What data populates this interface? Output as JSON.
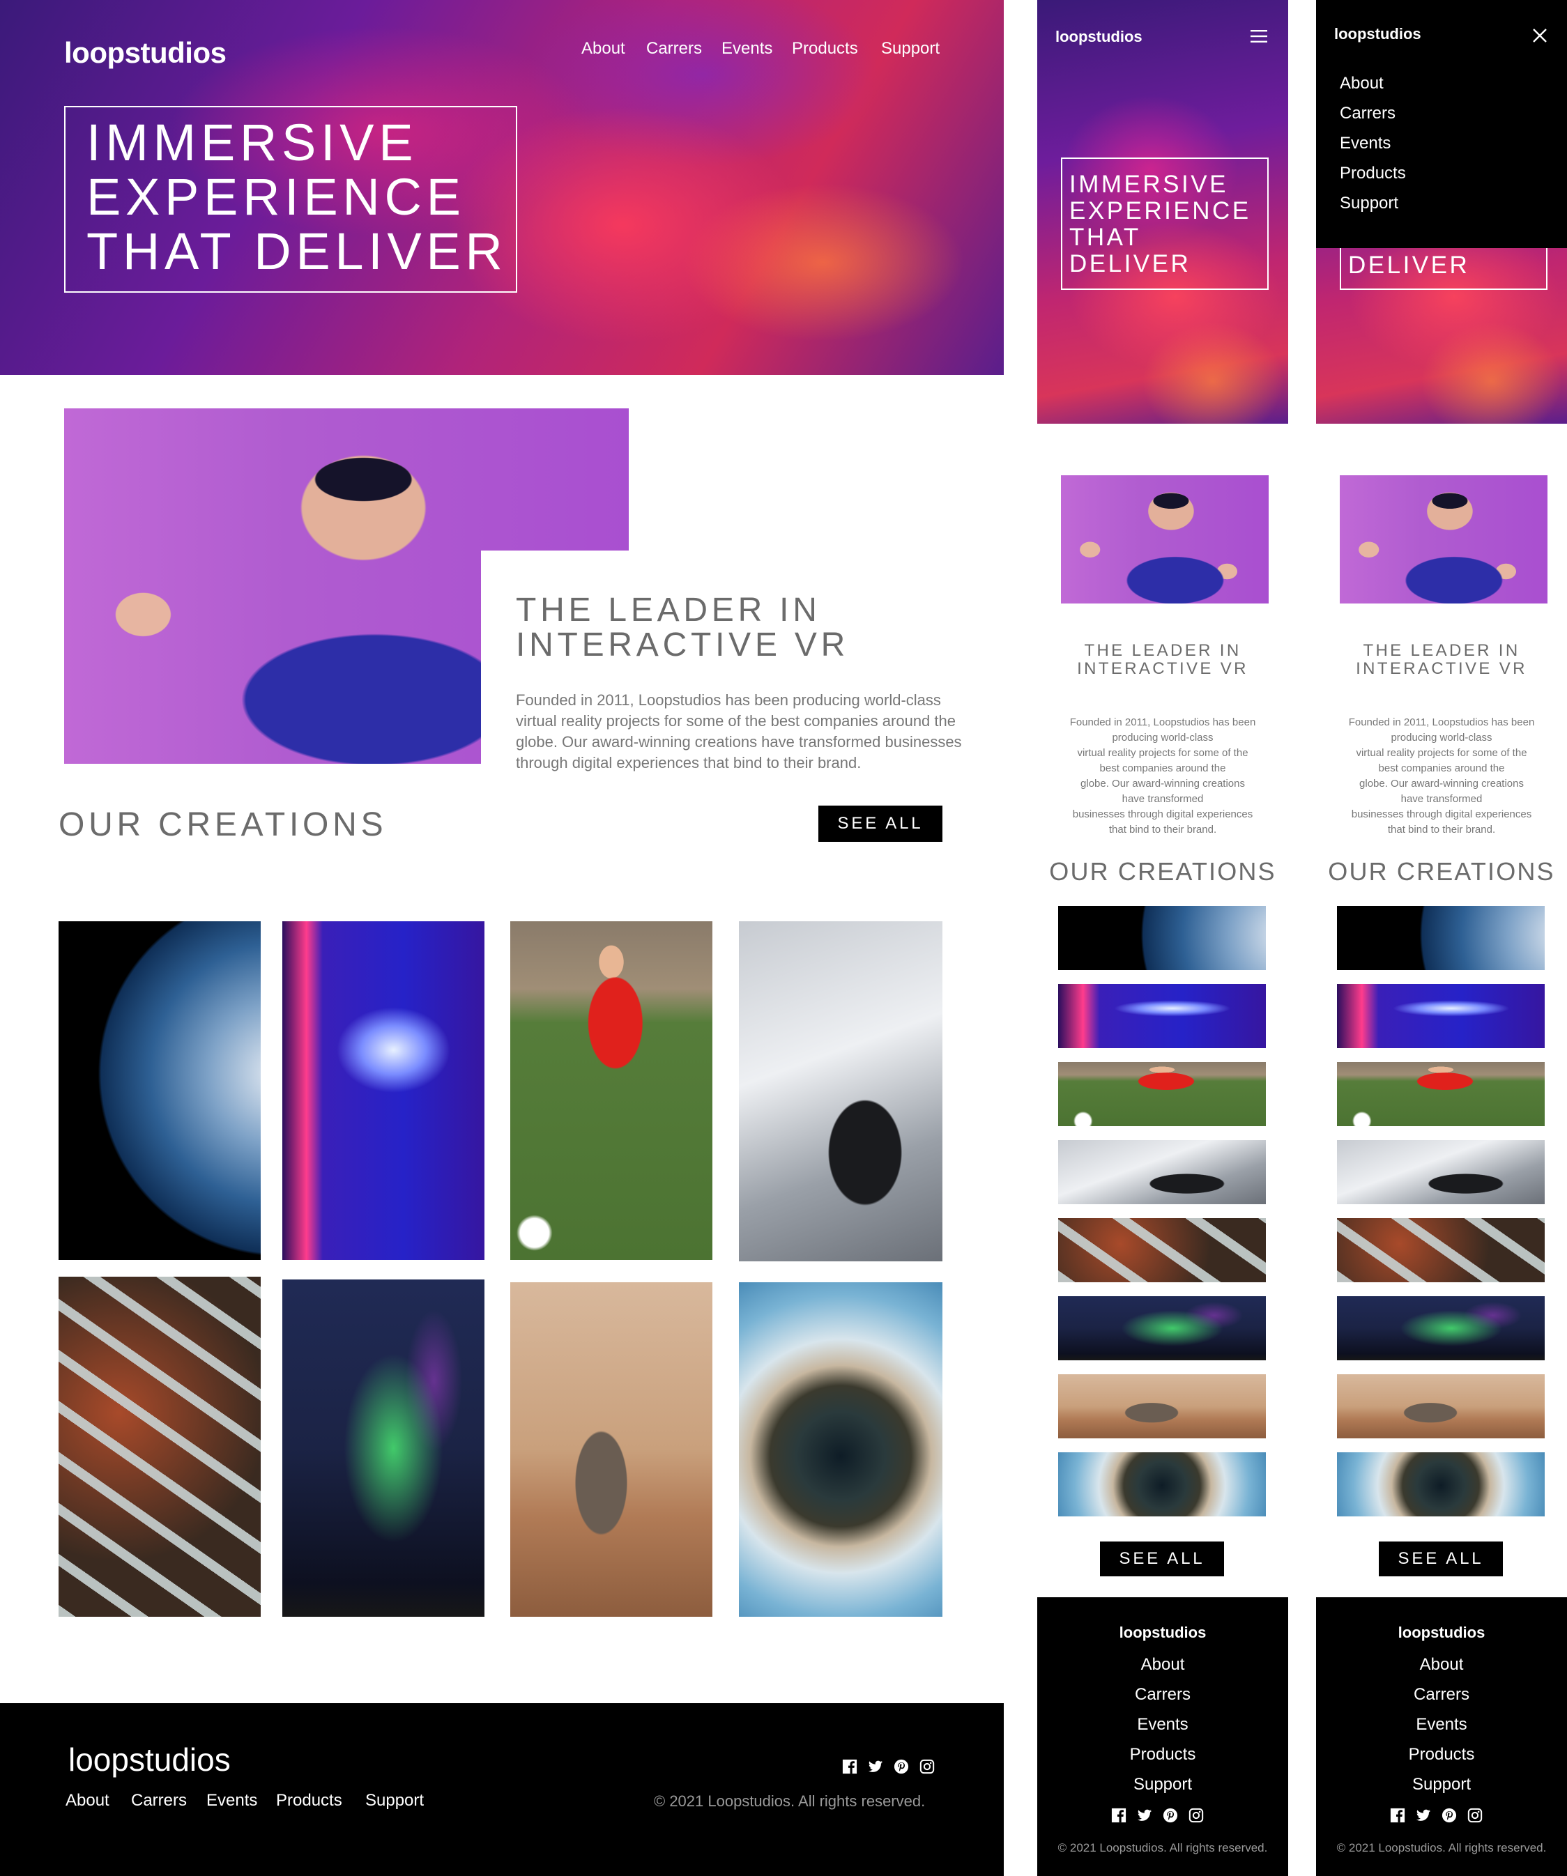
{
  "brand": {
    "logo": "loopstudios"
  },
  "nav": {
    "items": [
      "About",
      "Carrers",
      "Events",
      "Products",
      "Support"
    ]
  },
  "hero": {
    "title_line1": "IMMERSIVE",
    "title_line2": "EXPERIENCE",
    "title_line3": "THAT DELIVER",
    "mobile_line1": "IMMERSIVE",
    "mobile_line2": "EXPERIENCE",
    "mobile_line3": "THAT",
    "mobile_line4": "DELIVER"
  },
  "intro": {
    "title_line1": "THE LEADER IN",
    "title_line2": "INTERACTIVE VR",
    "text": "Founded in 2011, Loopstudios has been producing world-class virtual reality projects for some of the best companies around the globe. Our award-winning creations have transformed businesses through digital experiences that bind to their brand.",
    "mobile_lines": [
      "Founded in 2011, Loopstudios has been",
      "producing world-class",
      "virtual reality projects for some of the",
      "best companies around the",
      "globe. Our award-winning creations",
      "have transformed",
      "businesses through digital experiences",
      "that bind to their brand."
    ]
  },
  "creations": {
    "title": "OUR CREATIONS",
    "see_all": "SEE ALL",
    "items": [
      "earth",
      "skee-ball",
      "soccer",
      "race-car",
      "winding-road",
      "aurora",
      "mars-rover",
      "tiny-planet"
    ]
  },
  "footer": {
    "logo": "loopstudios",
    "copyright": "© 2021 Loopstudios. All rights reserved.",
    "social": [
      "facebook-icon",
      "twitter-icon",
      "pinterest-icon",
      "instagram-icon"
    ]
  },
  "icons": {
    "menu": "hamburger-icon",
    "close": "close-icon"
  }
}
